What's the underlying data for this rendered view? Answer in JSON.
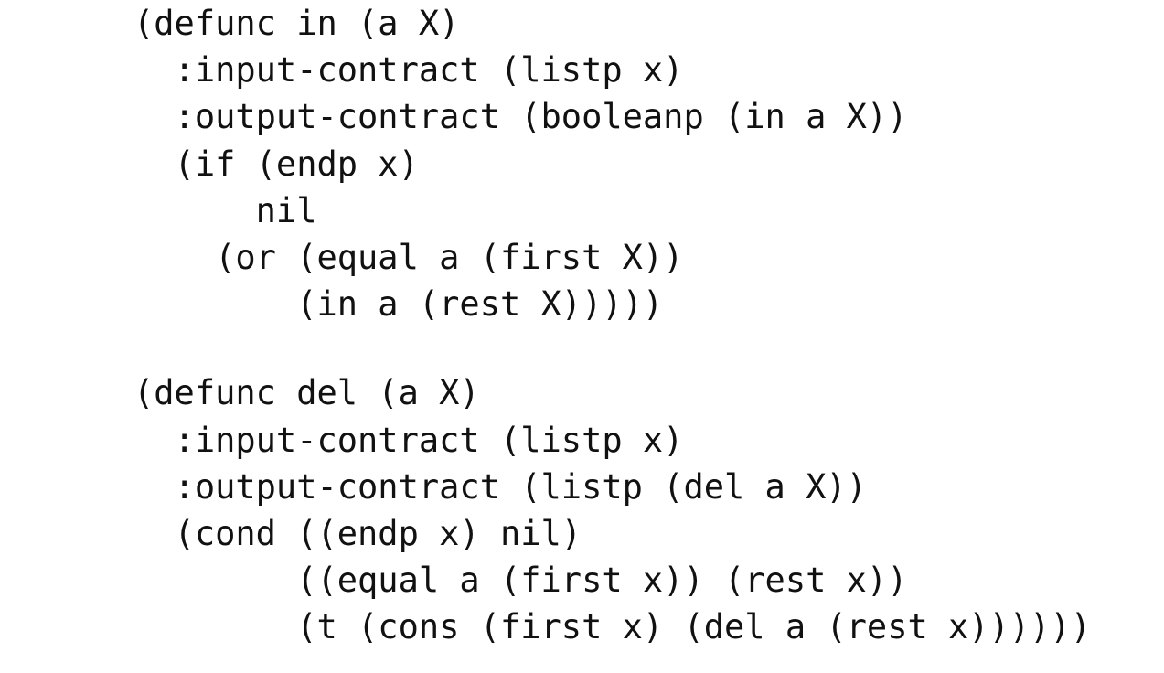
{
  "blocks": [
    {
      "lines": [
        "(defunc in (a X)",
        "  :input-contract (listp x)",
        "  :output-contract (booleanp (in a X))",
        "  (if (endp x)",
        "      nil",
        "    (or (equal a (first X))",
        "        (in a (rest X)))))"
      ]
    },
    {
      "lines": [
        "(defunc del (a X)",
        "  :input-contract (listp x)",
        "  :output-contract (listp (del a X))",
        "  (cond ((endp x) nil)",
        "        ((equal a (first x)) (rest x))",
        "        (t (cons (first x) (del a (rest x))))))"
      ]
    }
  ]
}
